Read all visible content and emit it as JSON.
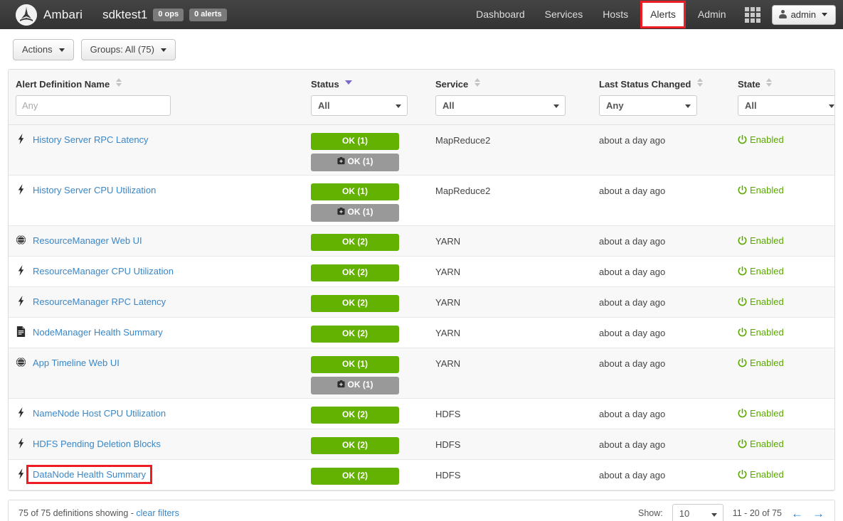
{
  "navbar": {
    "logo_icon": "ambari-logo-icon",
    "brand": "Ambari",
    "cluster": "sdktest1",
    "ops_pill": "0 ops",
    "alerts_pill": "0 alerts",
    "links": [
      {
        "label": "Dashboard",
        "active": false
      },
      {
        "label": "Services",
        "active": false
      },
      {
        "label": "Hosts",
        "active": false
      },
      {
        "label": "Alerts",
        "active": true
      },
      {
        "label": "Admin",
        "active": false
      }
    ],
    "grid_icon": "apps-grid-icon",
    "user": {
      "icon": "user-icon",
      "label": "admin",
      "caret": "caret-down-icon"
    },
    "highlight_color": "#ee1c25"
  },
  "toolbar": {
    "actions_label": "Actions",
    "groups_label": "Groups:  All (75)"
  },
  "table": {
    "columns": [
      {
        "key": "name",
        "label": "Alert Definition Name",
        "sort": "none",
        "filter_type": "input",
        "filter_value": "",
        "filter_placeholder": "Any"
      },
      {
        "key": "status",
        "label": "Status",
        "sort": "desc",
        "filter_type": "select",
        "filter_value": "All"
      },
      {
        "key": "service",
        "label": "Service",
        "sort": "none",
        "filter_type": "select",
        "filter_value": "All"
      },
      {
        "key": "changed",
        "label": "Last Status Changed",
        "sort": "none",
        "filter_type": "select",
        "filter_value": "Any"
      },
      {
        "key": "state",
        "label": "State",
        "sort": "none",
        "filter_type": "select",
        "filter_value": "All"
      }
    ],
    "rows": [
      {
        "icon": "lightning-bolt-icon",
        "name": "History Server RPC Latency",
        "highlighted": false,
        "badges": [
          {
            "text": "OK (1)",
            "kind": "ok"
          },
          {
            "text": "OK (1)",
            "kind": "muted",
            "icon": "mute-icon"
          }
        ],
        "service": "MapReduce2",
        "changed": "about a day ago",
        "state": "Enabled"
      },
      {
        "icon": "lightning-bolt-icon",
        "name": "History Server CPU Utilization",
        "highlighted": false,
        "badges": [
          {
            "text": "OK (1)",
            "kind": "ok"
          },
          {
            "text": "OK (1)",
            "kind": "muted",
            "icon": "mute-icon"
          }
        ],
        "service": "MapReduce2",
        "changed": "about a day ago",
        "state": "Enabled"
      },
      {
        "icon": "globe-icon",
        "name": "ResourceManager Web UI",
        "highlighted": false,
        "badges": [
          {
            "text": "OK (2)",
            "kind": "ok"
          }
        ],
        "service": "YARN",
        "changed": "about a day ago",
        "state": "Enabled"
      },
      {
        "icon": "lightning-bolt-icon",
        "name": "ResourceManager CPU Utilization",
        "highlighted": false,
        "badges": [
          {
            "text": "OK (2)",
            "kind": "ok"
          }
        ],
        "service": "YARN",
        "changed": "about a day ago",
        "state": "Enabled"
      },
      {
        "icon": "lightning-bolt-icon",
        "name": "ResourceManager RPC Latency",
        "highlighted": false,
        "badges": [
          {
            "text": "OK (2)",
            "kind": "ok"
          }
        ],
        "service": "YARN",
        "changed": "about a day ago",
        "state": "Enabled"
      },
      {
        "icon": "script-icon",
        "name": "NodeManager Health Summary",
        "highlighted": false,
        "badges": [
          {
            "text": "OK (2)",
            "kind": "ok"
          }
        ],
        "service": "YARN",
        "changed": "about a day ago",
        "state": "Enabled"
      },
      {
        "icon": "globe-icon",
        "name": "App Timeline Web UI",
        "highlighted": false,
        "badges": [
          {
            "text": "OK (1)",
            "kind": "ok"
          },
          {
            "text": "OK (1)",
            "kind": "muted",
            "icon": "mute-icon"
          }
        ],
        "service": "YARN",
        "changed": "about a day ago",
        "state": "Enabled"
      },
      {
        "icon": "lightning-bolt-icon",
        "name": "NameNode Host CPU Utilization",
        "highlighted": false,
        "badges": [
          {
            "text": "OK (2)",
            "kind": "ok"
          }
        ],
        "service": "HDFS",
        "changed": "about a day ago",
        "state": "Enabled"
      },
      {
        "icon": "lightning-bolt-icon",
        "name": "HDFS Pending Deletion Blocks",
        "highlighted": false,
        "badges": [
          {
            "text": "OK (2)",
            "kind": "ok"
          }
        ],
        "service": "HDFS",
        "changed": "about a day ago",
        "state": "Enabled"
      },
      {
        "icon": "lightning-bolt-icon",
        "name": "DataNode Health Summary",
        "highlighted": true,
        "badges": [
          {
            "text": "OK (2)",
            "kind": "ok"
          }
        ],
        "service": "HDFS",
        "changed": "about a day ago",
        "state": "Enabled"
      }
    ]
  },
  "footer": {
    "summary": "75 of 75 definitions showing -",
    "clear_filters": "clear filters",
    "show_label": "Show:",
    "page_size": "10",
    "range": "11 - 20 of 75",
    "prev_icon": "arrow-left-icon",
    "next_icon": "arrow-right-icon"
  },
  "colors": {
    "ok_green": "#63b100",
    "muted_gray": "#999999",
    "link_blue": "#3a87c8",
    "state_green": "#5aa700",
    "highlight_red": "#ee1c25",
    "sort_active": "#7b68c8"
  }
}
